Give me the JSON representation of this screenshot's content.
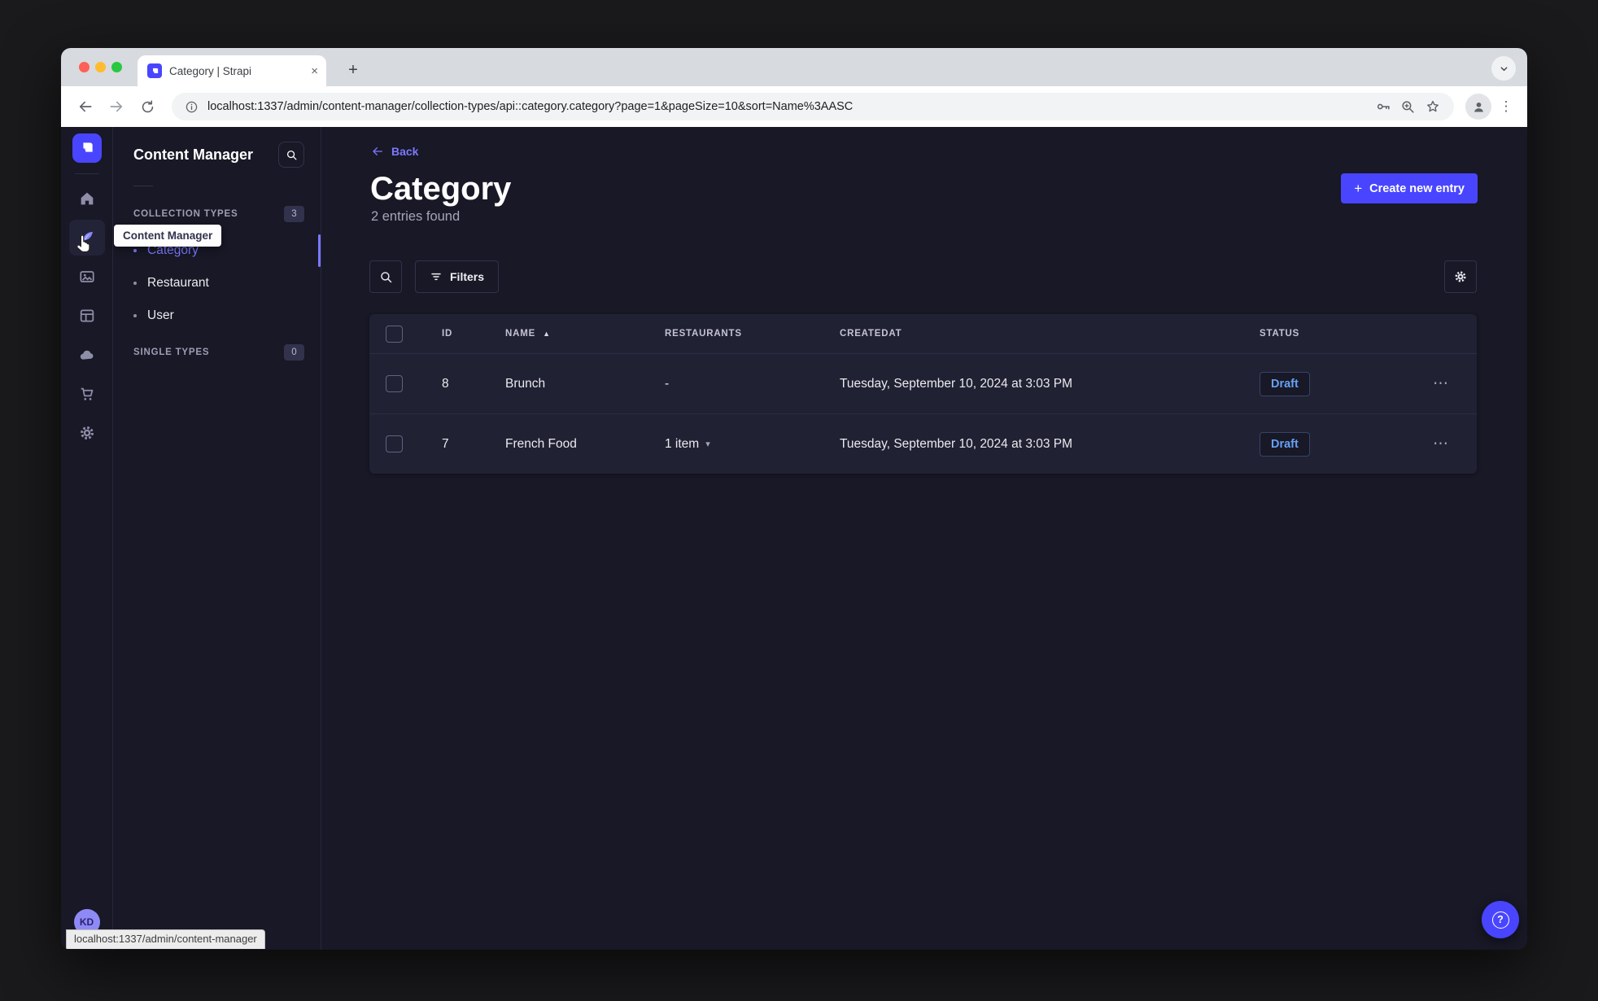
{
  "colors": {
    "accent": "#4945ff",
    "accent_light": "#7b79ff",
    "draft_text": "#66a0f5",
    "background": "#181826",
    "surface": "#212134",
    "border": "#32324d"
  },
  "browser": {
    "tab_title": "Category | Strapi",
    "url": "localhost:1337/admin/content-manager/collection-types/api::category.category?page=1&pageSize=10&sort=Name%3AASC",
    "status_bubble": "localhost:1337/admin/content-manager"
  },
  "icons": {
    "plus": "+",
    "close": "×",
    "more_horizontal": "⋯",
    "menu_vertical": "⋮",
    "sort_asc": "▲",
    "chevron_small_down": "▾",
    "question": "?"
  },
  "rail": {
    "user_initials": "KD"
  },
  "subnav": {
    "title": "Content Manager",
    "sections": [
      {
        "label": "COLLECTION TYPES",
        "count": "3",
        "items": [
          {
            "label": "Category"
          },
          {
            "label": "Restaurant"
          },
          {
            "label": "User"
          }
        ]
      },
      {
        "label": "SINGLE TYPES",
        "count": "0",
        "items": []
      }
    ]
  },
  "tooltip": {
    "label": "Content Manager"
  },
  "main": {
    "back_label": "Back",
    "title": "Category",
    "subtitle": "2 entries found",
    "create_button": "Create new entry",
    "filters_button": "Filters",
    "table": {
      "headers": {
        "id": "ID",
        "name": "NAME",
        "restaurants": "RESTAURANTS",
        "createdAt": "CREATEDAT",
        "status": "STATUS"
      },
      "rows": [
        {
          "id": "8",
          "name": "Brunch",
          "restaurants": "-",
          "createdAt": "Tuesday, September 10, 2024 at 3:03 PM",
          "status": "Draft"
        },
        {
          "id": "7",
          "name": "French Food",
          "restaurants": "1 item",
          "createdAt": "Tuesday, September 10, 2024 at 3:03 PM",
          "status": "Draft"
        }
      ]
    }
  }
}
